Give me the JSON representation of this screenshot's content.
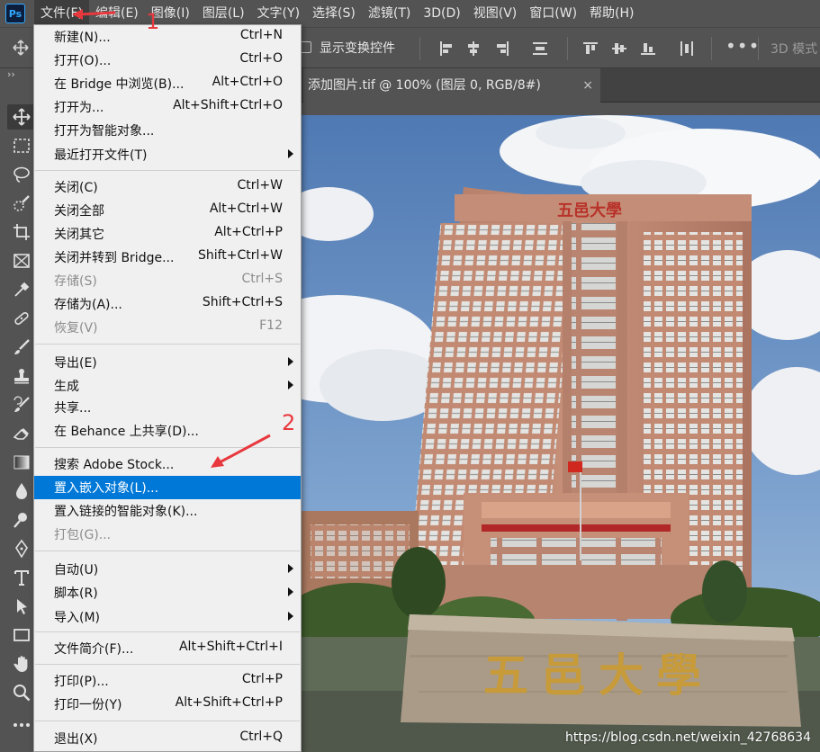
{
  "app": {
    "logo": "Ps"
  },
  "menubar": {
    "items": [
      {
        "label": "文件(F)",
        "active": true
      },
      {
        "label": "编辑(E)"
      },
      {
        "label": "图像(I)"
      },
      {
        "label": "图层(L)"
      },
      {
        "label": "文字(Y)"
      },
      {
        "label": "选择(S)"
      },
      {
        "label": "滤镜(T)"
      },
      {
        "label": "3D(D)"
      },
      {
        "label": "视图(V)"
      },
      {
        "label": "窗口(W)"
      },
      {
        "label": "帮助(H)"
      }
    ]
  },
  "options": {
    "show_transform_label": "显示变换控件",
    "mode_label": "3D 模式"
  },
  "toolbar": {
    "collapse_icon": "double-chevron-icon",
    "tools": [
      "move-tool-icon",
      "marquee-tool-icon",
      "lasso-tool-icon",
      "quick-select-icon",
      "crop-tool-icon",
      "frame-tool-icon",
      "eyedropper-icon",
      "healing-brush-icon",
      "brush-tool-icon",
      "stamp-tool-icon",
      "history-brush-icon",
      "eraser-icon",
      "gradient-icon",
      "blur-icon",
      "dodge-icon",
      "pen-tool-icon",
      "type-tool-icon",
      "path-select-icon",
      "rectangle-tool-icon",
      "hand-tool-icon",
      "zoom-tool-icon",
      "more-tools-icon"
    ]
  },
  "document": {
    "tab_title": "添加图片.tif @ 100% (图层 0, RGB/8#)",
    "close": "×"
  },
  "photo": {
    "building_sign": "五邑大學",
    "stone_sign": "五邑大學",
    "watermark": "https://blog.csdn.net/weixin_42768634"
  },
  "file_menu": {
    "items": [
      {
        "label": "新建(N)...",
        "shortcut": "Ctrl+N"
      },
      {
        "label": "打开(O)...",
        "shortcut": "Ctrl+O"
      },
      {
        "label": "在 Bridge 中浏览(B)...",
        "shortcut": "Alt+Ctrl+O"
      },
      {
        "label": "打开为...",
        "shortcut": "Alt+Shift+Ctrl+O"
      },
      {
        "label": "打开为智能对象...",
        "shortcut": ""
      },
      {
        "label": "最近打开文件(T)",
        "shortcut": "",
        "submenu": true
      },
      {
        "label": "关闭(C)",
        "shortcut": "Ctrl+W"
      },
      {
        "label": "关闭全部",
        "shortcut": "Alt+Ctrl+W"
      },
      {
        "label": "关闭其它",
        "shortcut": "Alt+Ctrl+P"
      },
      {
        "label": "关闭并转到 Bridge...",
        "shortcut": "Shift+Ctrl+W"
      },
      {
        "label": "存储(S)",
        "shortcut": "Ctrl+S",
        "disabled": true
      },
      {
        "label": "存储为(A)...",
        "shortcut": "Shift+Ctrl+S"
      },
      {
        "label": "恢复(V)",
        "shortcut": "F12",
        "disabled": true
      },
      {
        "label": "导出(E)",
        "shortcut": "",
        "submenu": true
      },
      {
        "label": "生成",
        "shortcut": "",
        "submenu": true
      },
      {
        "label": "共享...",
        "shortcut": ""
      },
      {
        "label": "在 Behance 上共享(D)...",
        "shortcut": ""
      },
      {
        "label": "搜索 Adobe Stock...",
        "shortcut": ""
      },
      {
        "label": "置入嵌入对象(L)...",
        "shortcut": "",
        "highlighted": true
      },
      {
        "label": "置入链接的智能对象(K)...",
        "shortcut": ""
      },
      {
        "label": "打包(G)...",
        "shortcut": "",
        "disabled": true
      },
      {
        "label": "自动(U)",
        "shortcut": "",
        "submenu": true
      },
      {
        "label": "脚本(R)",
        "shortcut": "",
        "submenu": true
      },
      {
        "label": "导入(M)",
        "shortcut": "",
        "submenu": true
      },
      {
        "label": "文件简介(F)...",
        "shortcut": "Alt+Shift+Ctrl+I"
      },
      {
        "label": "打印(P)...",
        "shortcut": "Ctrl+P"
      },
      {
        "label": "打印一份(Y)",
        "shortcut": "Alt+Shift+Ctrl+P"
      },
      {
        "label": "退出(X)",
        "shortcut": "Ctrl+Q"
      }
    ]
  },
  "annotations": {
    "step1": "1",
    "step2": "2",
    "color": "#e8383d"
  },
  "colors": {
    "accent": "#0078d7",
    "chrome": "#535353",
    "menu_bg": "#f0f0f0"
  }
}
